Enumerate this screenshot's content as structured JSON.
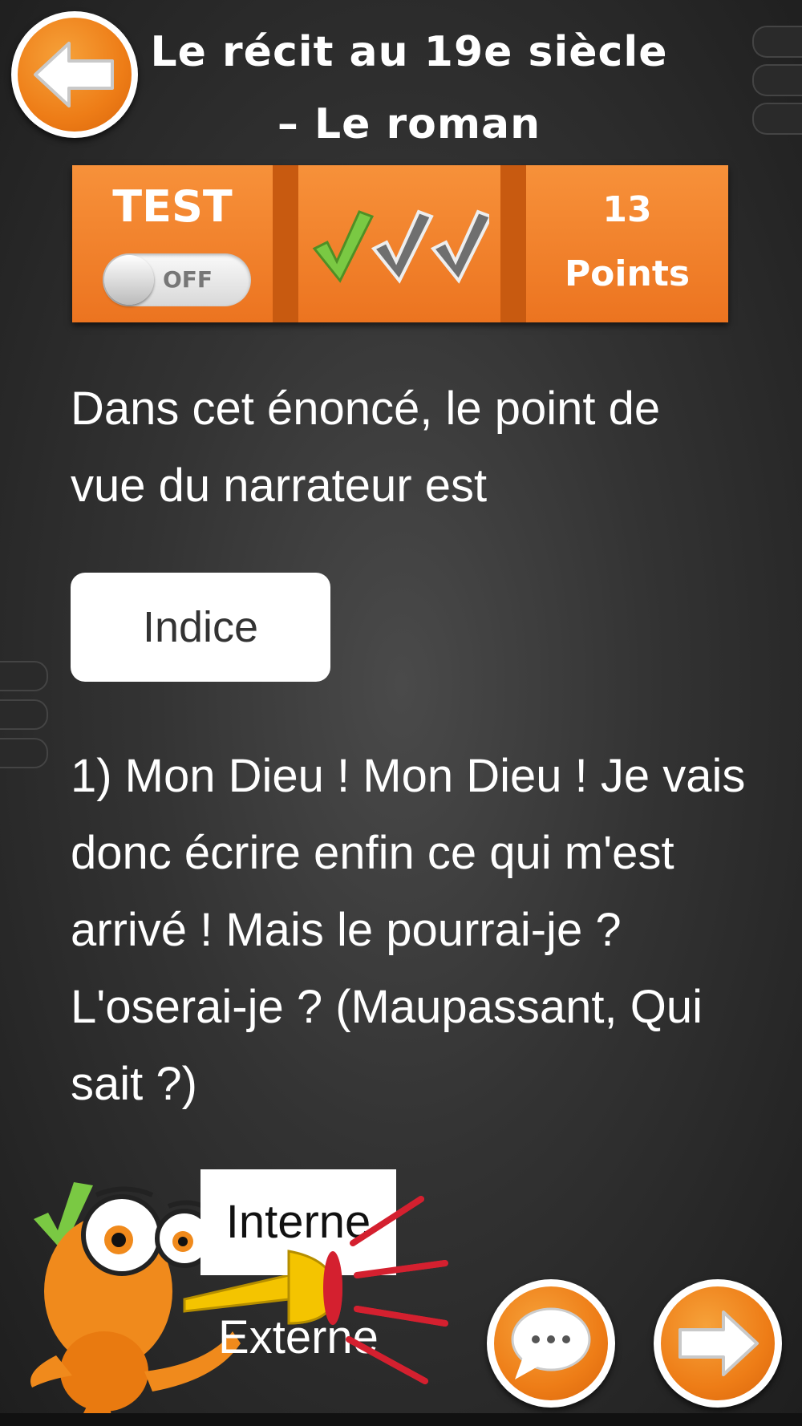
{
  "header": {
    "title_line1": "Le récit au 19e siècle",
    "title_line2": "– Le roman",
    "back_icon": "arrow-left-icon"
  },
  "status": {
    "test_label": "TEST",
    "toggle_state": "OFF",
    "checks": [
      {
        "state": "correct",
        "color": "#7ac943"
      },
      {
        "state": "pending",
        "color": "#6f6f6f"
      },
      {
        "state": "pending",
        "color": "#6f6f6f"
      }
    ],
    "points_value": "13",
    "points_label": "Points"
  },
  "question": {
    "prompt": "Dans cet énoncé, le point de vue du narrateur est",
    "hint_label": "Indice",
    "passage": "1) Mon Dieu ! Mon Dieu ! Je vais donc écrire enfin ce qui m'est arrivé ! Mais le pourrai-je ? L'oserai-je ? (Maupassant, Qui sait ?)"
  },
  "answers": [
    {
      "label": "Interne",
      "selected": true
    },
    {
      "label": "Externe",
      "selected": false
    }
  ],
  "footer": {
    "chat_icon": "speech-bubble-icon",
    "next_icon": "arrow-right-icon"
  },
  "colors": {
    "accent": "#ee7d17",
    "background": "#333333"
  }
}
